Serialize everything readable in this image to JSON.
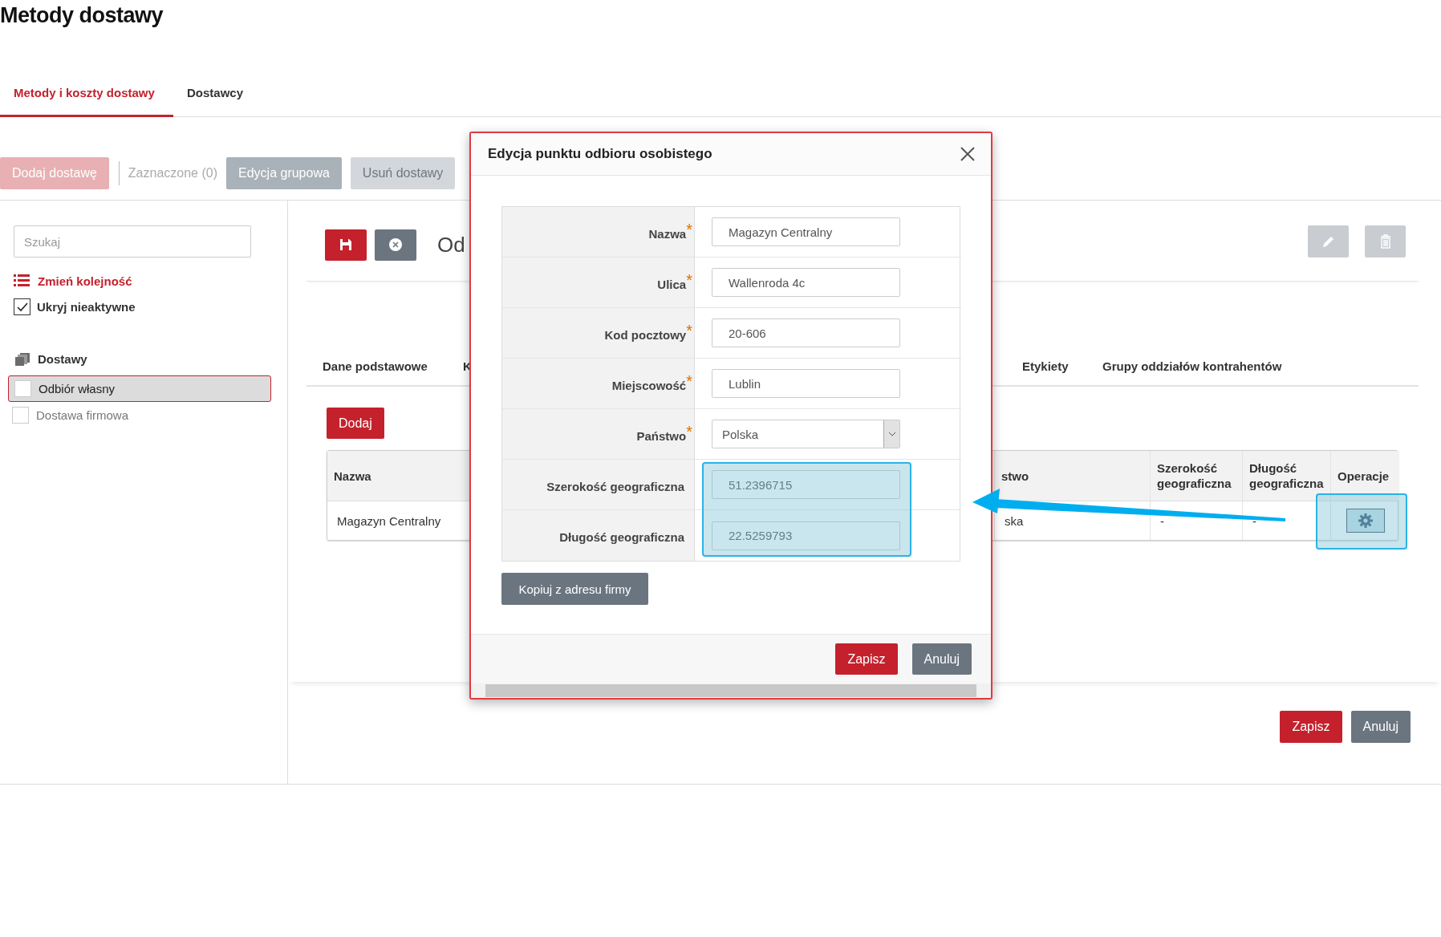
{
  "page_title": "Metody dostawy",
  "tabs": [
    {
      "label": "Metody i koszty dostawy",
      "selected": true
    },
    {
      "label": "Dostawcy",
      "selected": false
    }
  ],
  "toolbar": [
    {
      "kind": "primary",
      "label": "Dodaj dostawę",
      "disabled": true
    },
    {
      "kind": "counter",
      "label": "Zaznaczone (0)"
    },
    {
      "kind": "secondary",
      "label": "Edycja grupowa",
      "disabled": false
    },
    {
      "kind": "secondary",
      "label": "Usuń dostawy",
      "disabled": true
    }
  ],
  "sidebar": {
    "search": {
      "placeholder": "Szukaj"
    },
    "reorder_link": "Zmień kolejność",
    "hide_inactive": {
      "label": "Ukryj nieaktywne",
      "checked": true
    },
    "section": "Dostawy",
    "items": [
      {
        "label": "Odbiór własny",
        "selected": true,
        "checked": false
      },
      {
        "label": "Dostawa firmowa",
        "selected": false,
        "checked": false
      }
    ]
  },
  "content": {
    "title": "Od",
    "subtabs": [
      {
        "label": "Dane podstawowe",
        "selected": false
      },
      {
        "label": "K",
        "selected": false
      },
      {
        "label": "Etykiety",
        "selected": false
      },
      {
        "label": "Grupy oddziałów kontrahentów",
        "selected": false
      }
    ],
    "add_button": "Dodaj",
    "table": {
      "columns": [
        "Nazwa",
        "stwo",
        "Szerokość geograficzna",
        "Długość geograficzna",
        "Operacje"
      ],
      "rows": [
        {
          "cells": [
            "Magazyn Centralny",
            "ska",
            "-",
            "-"
          ]
        }
      ]
    },
    "footer_buttons": [
      {
        "kind": "primary",
        "label": "Zapisz"
      },
      {
        "kind": "secondary",
        "label": "Anuluj"
      }
    ]
  },
  "modal": {
    "title": "Edycja punktu odbioru osobistego",
    "required_mark": "*",
    "fields": [
      {
        "label": "Nazwa",
        "required": true,
        "kind": "text",
        "value": "Magazyn Centralny"
      },
      {
        "label": "Ulica",
        "required": true,
        "kind": "text",
        "value": "Wallenroda 4c"
      },
      {
        "label": "Kod pocztowy",
        "required": true,
        "kind": "text",
        "value": "20-606"
      },
      {
        "label": "Miejscowość",
        "required": true,
        "kind": "text",
        "value": "Lublin"
      },
      {
        "label": "Państwo",
        "required": true,
        "kind": "select",
        "value": "Polska"
      },
      {
        "label": "Szerokość geograficzna",
        "required": false,
        "kind": "text",
        "value": "51.2396715"
      },
      {
        "label": "Długość geograficzna",
        "required": false,
        "kind": "text",
        "value": "22.5259793"
      }
    ],
    "copy_button": "Kopiuj z adresu firmy",
    "footer_buttons": [
      {
        "kind": "primary",
        "label": "Zapisz"
      },
      {
        "kind": "secondary",
        "label": "Anuluj"
      }
    ]
  }
}
